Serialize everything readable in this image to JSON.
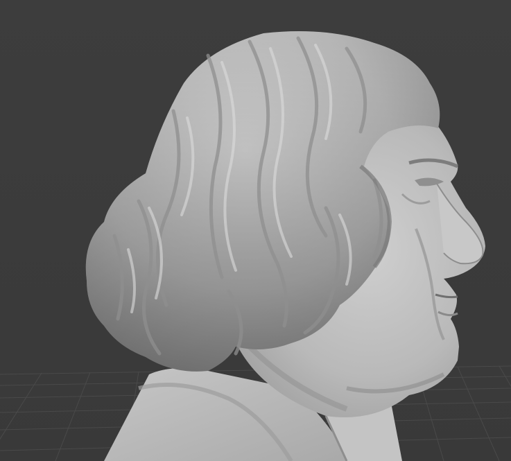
{
  "viewport": {
    "mode": "3d-sculpt-view",
    "object": "bust-icon",
    "background_color": "#3b3b3b",
    "grid_color": "#4a4a4a",
    "model_color": "#b4b4b4"
  }
}
